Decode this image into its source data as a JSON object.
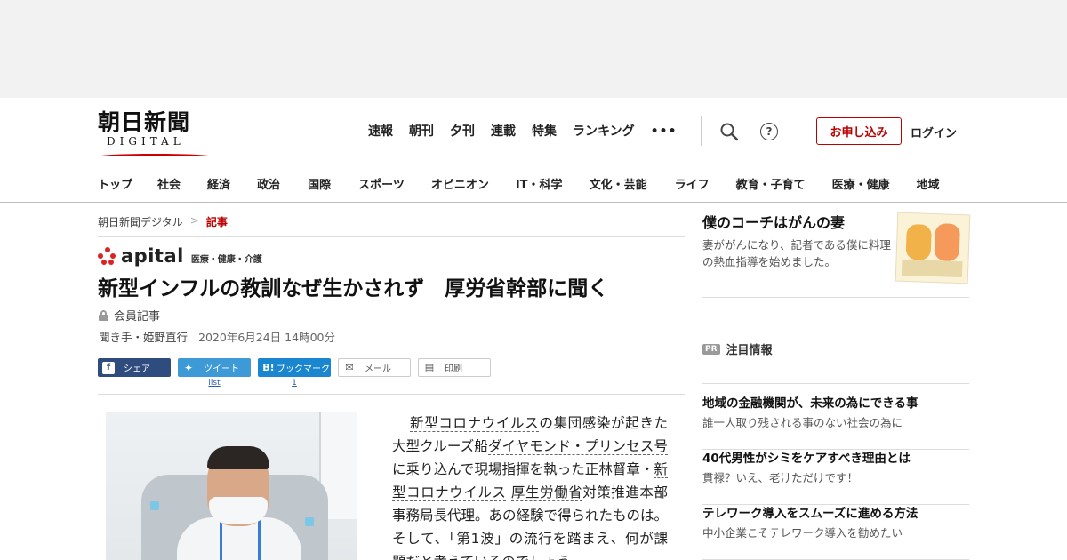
{
  "logo": {
    "main": "朝日新聞",
    "sub": "DIGITAL"
  },
  "header_nav": [
    "速報",
    "朝刊",
    "夕刊",
    "連載",
    "特集",
    "ランキング"
  ],
  "header": {
    "more_icon": "more-dots-icon",
    "search_icon": "search-icon",
    "help_icon": "help-icon",
    "signup_label": "お申し込み",
    "login_label": "ログイン"
  },
  "category_nav": [
    "トップ",
    "社会",
    "経済",
    "政治",
    "国際",
    "スポーツ",
    "オピニオン",
    "IT・科学",
    "文化・芸能",
    "ライフ",
    "教育・子育て",
    "医療・健康",
    "地域"
  ],
  "breadcrumb": {
    "home": "朝日新聞デジタル",
    "current": "記事"
  },
  "section": {
    "brand": "apital",
    "sub": "医療・健康・介護"
  },
  "article": {
    "headline": "新型インフルの教訓なぜ生かされず　厚労省幹部に聞く",
    "member_label": "会員記事",
    "byline": "聞き手・姫野直行",
    "date": "2020年6月24日 14時00分",
    "body": {
      "kw1": "新型コロナウイルス",
      "t1": "の集団感染が起きた大型クルーズ船",
      "kw2": "ダイヤモンド・プリンセス号",
      "t2": "に乗り込んで現場指揮を執った正林督章・",
      "kw3": "新型コロナウイルス",
      "t3": " ",
      "kw4": "厚生労働省",
      "t4": "対策推進本部事務局長代理。あの経験で得られたものは。そして、「第1波」の流行を踏まえ、何が課題だと考えているのでしょう"
    }
  },
  "share": {
    "facebook": "シェア",
    "twitter": "ツイート",
    "twitter_count": "list",
    "hatena": "ブックマーク",
    "hatena_count": "1",
    "mail": "メール",
    "print": "印刷"
  },
  "promo": {
    "title": "僕のコーチはがんの妻",
    "text": "妻ががんになり、記者である僕に料理の熱血指導を始めました。"
  },
  "pr": {
    "tag": "PR",
    "label": "注目情報",
    "items": [
      {
        "title": "地域の金融機関が、未来の為にできる事",
        "desc": "誰一人取り残される事のない社会の為に"
      },
      {
        "title": "40代男性がシミをケアすべき理由とは",
        "desc": "貫禄？いえ、老けただけです！"
      },
      {
        "title": "テレワーク導入をスムーズに進める方法",
        "desc": "中小企業こそテレワーク導入を勧めたい"
      }
    ]
  }
}
